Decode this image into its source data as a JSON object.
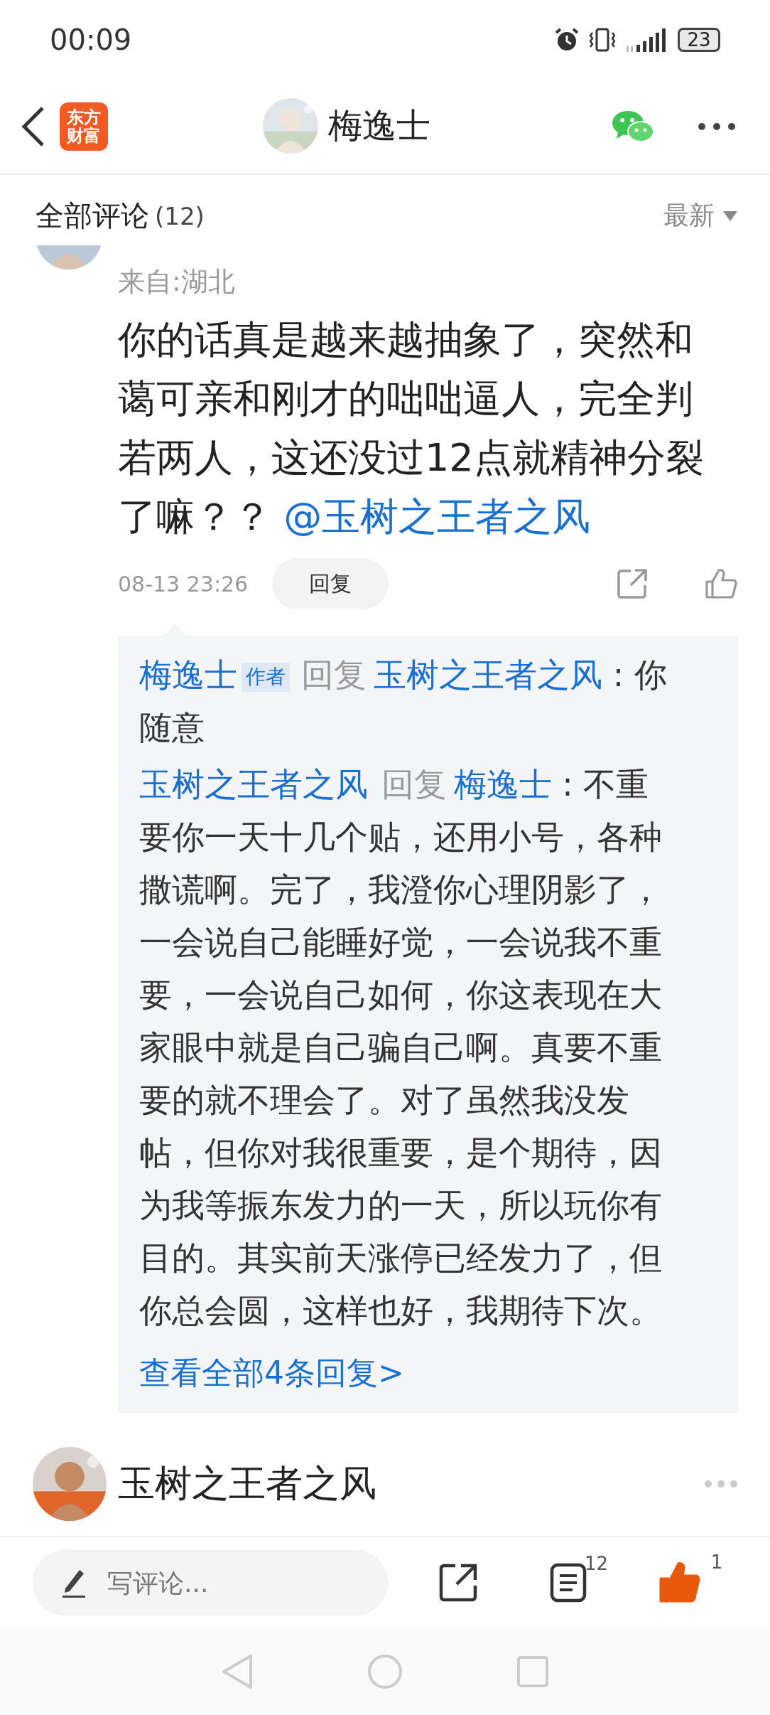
{
  "status_bar": {
    "time": "00:09",
    "battery": "23"
  },
  "header": {
    "logo_lines": [
      "东方",
      "财富"
    ],
    "title": "梅逸士"
  },
  "comments_header": {
    "title": "全部评论",
    "count": "(12)",
    "sort": "最新"
  },
  "comments": [
    {
      "location": "来自:湖北",
      "text": "你的话真是越来越抽象了，突然和蔼可亲和刚才的咄咄逼人，完全判若两人，这还没过12点就精神分裂了嘛？？",
      "mention": "@玉树之王者之风",
      "time": "08-13 23:26",
      "reply_button": "回复",
      "replies": [
        {
          "author": "梅逸士",
          "badge": "作者",
          "verb": "回复",
          "target": "玉树之王者之风",
          "text": ": 你随意"
        },
        {
          "author": "玉树之王者之风",
          "verb": "回复",
          "target": "梅逸士",
          "text": ": 不重要你一天十几个贴，还用小号，各种撒谎啊。完了，我澄你心理阴影了，一会说自己能睡好觉，一会说我不重要，一会说自己如何，你这表现在大家眼中就是自己骗自己啊。真要不重要的就不理会了。对了虽然我没发帖，但你对我很重要，是个期待，因为我等振东发力的一天，所以玩你有目的。其实前天涨停已经发力了，但你总会圆，这样也好，我期待下次。"
        }
      ],
      "more_replies": "查看全部4条回复>"
    },
    {
      "author": "玉树之王者之风"
    }
  ],
  "bottom_bar": {
    "placeholder": "写评论...",
    "comment_count": "12",
    "like_count": "1",
    "liked": true
  }
}
